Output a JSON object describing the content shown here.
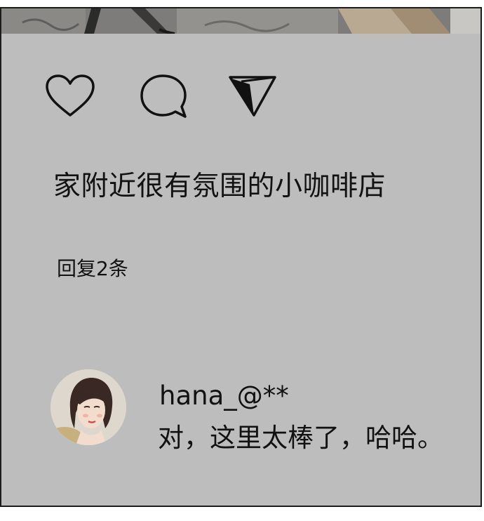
{
  "post": {
    "actions": [
      {
        "icon": "heart-icon"
      },
      {
        "icon": "comment-icon"
      },
      {
        "icon": "send-icon"
      }
    ],
    "caption": "家附近很有氛围的小咖啡店",
    "replies_label": "回复2条"
  },
  "comment": {
    "username": "hana_@**",
    "text": "对，这里太棒了，哈哈。"
  },
  "colors": {
    "card_background": "#bdbdbd",
    "frame_border": "#1c1c1c",
    "text": "#121212"
  }
}
